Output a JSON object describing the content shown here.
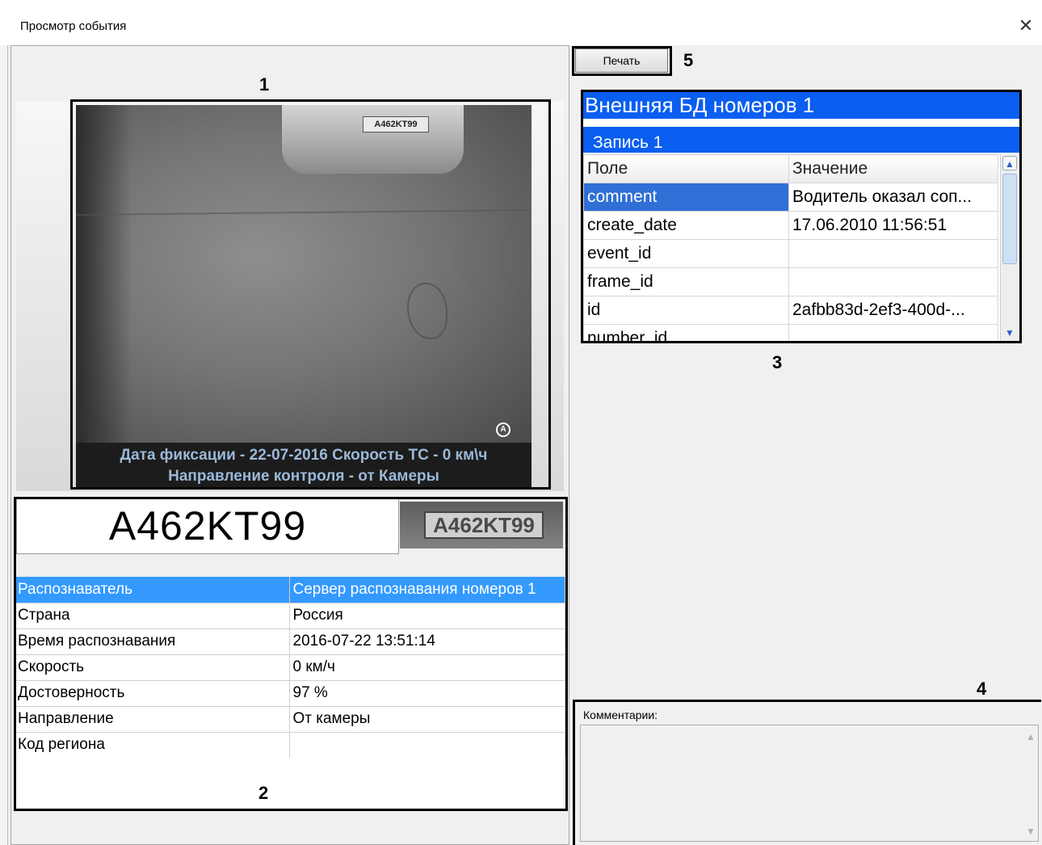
{
  "window": {
    "title": "Просмотр события",
    "close_glyph": "✕"
  },
  "callouts": [
    "1",
    "2",
    "3",
    "4",
    "5"
  ],
  "photo": {
    "car_plate": "A462KT99",
    "logo_glyph": "A",
    "caption_line1": "Дата фиксации - 22-07-2016  Скорость ТС - 0 км\\ч",
    "caption_line2": "Направление контроля - от Камеры"
  },
  "recognized_plate": "A462KT99",
  "plate_thumb_text": "A462KT99",
  "properties": [
    {
      "name": "Распознаватель",
      "value": "Сервер распознавания номеров 1",
      "selected": true
    },
    {
      "name": "Страна",
      "value": "Россия"
    },
    {
      "name": "Время распознавания",
      "value": "2016-07-22 13:51:14"
    },
    {
      "name": "Скорость",
      "value": "0 км/ч"
    },
    {
      "name": "Достоверность",
      "value": "97 %"
    },
    {
      "name": "Направление",
      "value": "От камеры"
    },
    {
      "name": "Код региона",
      "value": ""
    }
  ],
  "toolbar": {
    "print_label": "Печать"
  },
  "db_panel": {
    "title": "Внешняя БД номеров 1",
    "record_label": "Запись 1",
    "columns": [
      "Поле",
      "Значение"
    ],
    "rows": [
      {
        "field": "comment",
        "value": "Водитель оказал соп..."
      },
      {
        "field": "create_date",
        "value": "17.06.2010 11:56:51"
      },
      {
        "field": "event_id",
        "value": ""
      },
      {
        "field": "frame_id",
        "value": ""
      },
      {
        "field": "id",
        "value": "2afbb83d-2ef3-400d-..."
      },
      {
        "field": "number_id",
        "value": ""
      }
    ]
  },
  "comments": {
    "label": "Комментарии:",
    "value": ""
  },
  "colors": {
    "selection": "#3399ff",
    "db_header": "#0a5ef0"
  }
}
